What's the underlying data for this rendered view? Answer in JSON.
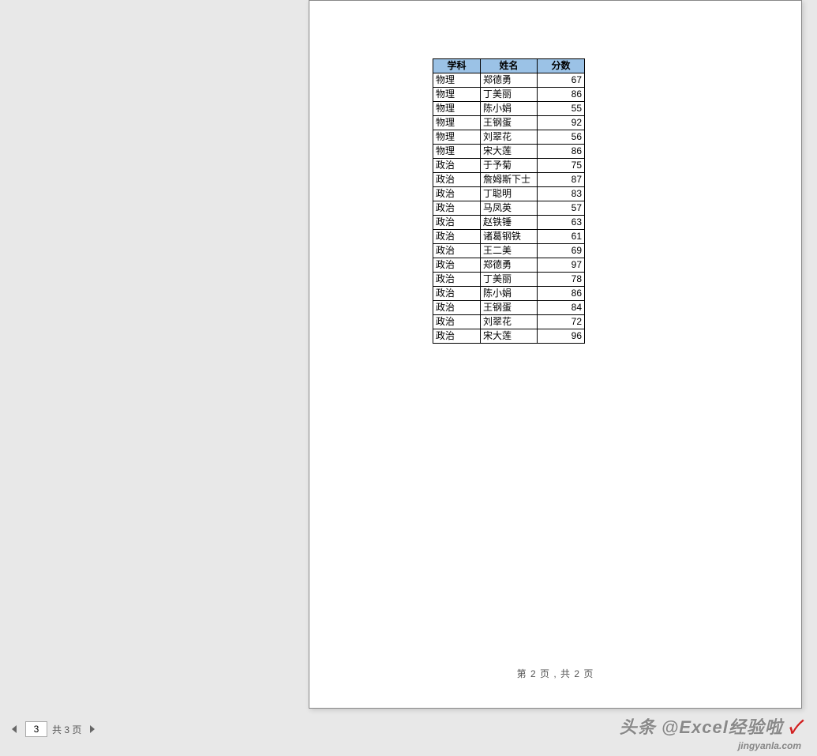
{
  "table": {
    "headers": {
      "subject": "学科",
      "name": "姓名",
      "score": "分数"
    },
    "rows": [
      {
        "subject": "物理",
        "name": "郑德勇",
        "score": "67"
      },
      {
        "subject": "物理",
        "name": "丁美丽",
        "score": "86"
      },
      {
        "subject": "物理",
        "name": "陈小娟",
        "score": "55"
      },
      {
        "subject": "物理",
        "name": "王钢蛋",
        "score": "92"
      },
      {
        "subject": "物理",
        "name": "刘翠花",
        "score": "56"
      },
      {
        "subject": "物理",
        "name": "宋大莲",
        "score": "86"
      },
      {
        "subject": "政治",
        "name": "于予菊",
        "score": "75"
      },
      {
        "subject": "政治",
        "name": "詹姆斯下士",
        "score": "87"
      },
      {
        "subject": "政治",
        "name": "丁聪明",
        "score": "83"
      },
      {
        "subject": "政治",
        "name": "马凤英",
        "score": "57"
      },
      {
        "subject": "政治",
        "name": "赵铁锤",
        "score": "63"
      },
      {
        "subject": "政治",
        "name": "诸葛钢铁",
        "score": "61"
      },
      {
        "subject": "政治",
        "name": "王二美",
        "score": "69"
      },
      {
        "subject": "政治",
        "name": "郑德勇",
        "score": "97"
      },
      {
        "subject": "政治",
        "name": "丁美丽",
        "score": "78"
      },
      {
        "subject": "政治",
        "name": "陈小娟",
        "score": "86"
      },
      {
        "subject": "政治",
        "name": "王钢蛋",
        "score": "84"
      },
      {
        "subject": "政治",
        "name": "刘翠花",
        "score": "72"
      },
      {
        "subject": "政治",
        "name": "宋大莲",
        "score": "96"
      }
    ]
  },
  "footer": {
    "text": "第 2 页 , 共 2 页"
  },
  "nav": {
    "page_input": "3",
    "total_text": "共 3 页"
  },
  "watermark": {
    "main_a": "头条 @Excel经验啦",
    "mark": "✓",
    "sub": "jingyanla.com"
  }
}
